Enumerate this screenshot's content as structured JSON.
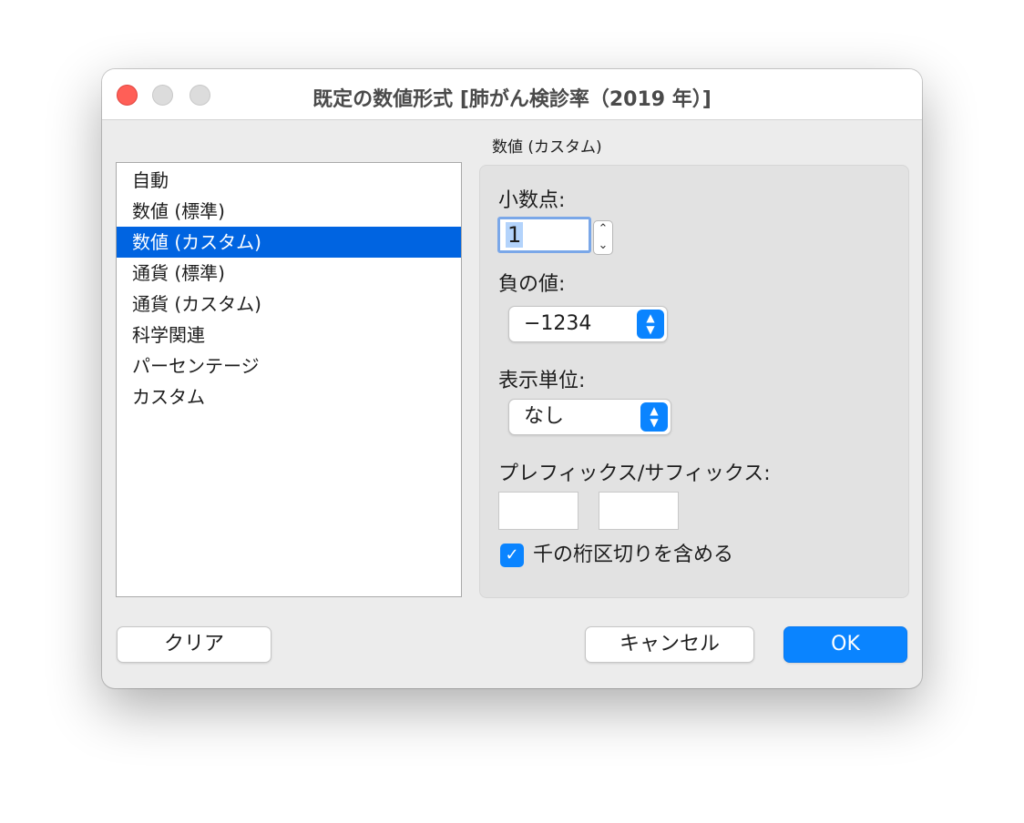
{
  "window": {
    "title": "既定の数値形式 [肺がん検診率（2019 年）]"
  },
  "list": {
    "items": [
      {
        "label": "自動"
      },
      {
        "label": "数値 (標準)"
      },
      {
        "label": "数値 (カスタム)"
      },
      {
        "label": "通貨 (標準)"
      },
      {
        "label": "通貨 (カスタム)"
      },
      {
        "label": "科学関連"
      },
      {
        "label": "パーセンテージ"
      },
      {
        "label": "カスタム"
      }
    ],
    "selected_index": 2
  },
  "panel": {
    "section_label": "数値 (カスタム)",
    "decimals_label": "小数点:",
    "decimals_value": "1",
    "negative_label": "負の値:",
    "negative_value": "−1234",
    "units_label": "表示単位:",
    "units_value": "なし",
    "affix_label": "プレフィックス/サフィックス:",
    "prefix_value": "",
    "suffix_value": "",
    "thousands_label": "千の桁区切りを含める",
    "thousands_checked": true
  },
  "buttons": {
    "clear": "クリア",
    "cancel": "キャンセル",
    "ok": "OK"
  },
  "colors": {
    "accent": "#0a84ff",
    "selection": "#0064e1"
  }
}
